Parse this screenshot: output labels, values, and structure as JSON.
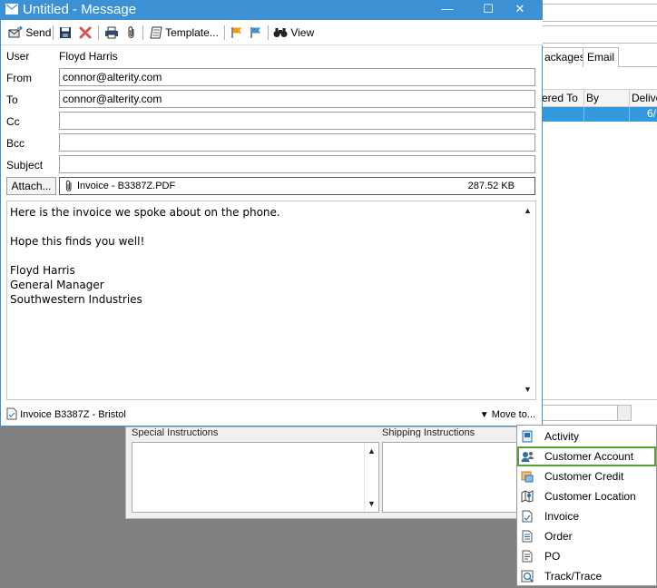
{
  "window": {
    "title": "Untitled - Message",
    "minimize": "—",
    "maximize": "☐",
    "close": "✕"
  },
  "toolbar": {
    "send": "Send",
    "template": "Template...",
    "view": "View"
  },
  "fields": {
    "user_label": "User",
    "user_value": "Floyd Harris",
    "from_label": "From",
    "from_value": "connor@alterity.com",
    "to_label": "To",
    "to_value": "connor@alterity.com",
    "cc_label": "Cc",
    "cc_value": "",
    "bcc_label": "Bcc",
    "bcc_value": "",
    "subject_label": "Subject",
    "subject_value": ""
  },
  "attachment": {
    "button": "Attach...",
    "file_name": "Invoice - B3387Z.PDF",
    "file_size": "287.52 KB"
  },
  "body": {
    "text": "Here is the invoice we spoke about on the phone.\n\nHope this finds you well!\n\nFloyd Harris\nGeneral Manager\nSouthwestern Industries"
  },
  "footer": {
    "link_text": "Invoice B3387Z - Bristol",
    "move_to": "Move to..."
  },
  "background": {
    "tab_packages": "ackages",
    "tab_email": "Email",
    "col_ordered_to": "ered To",
    "col_by": "By",
    "col_delivered": "Delive",
    "row_date": "6/",
    "special_instructions": "Special Instructions",
    "shipping_instructions": "Shipping Instructions"
  },
  "context_menu": {
    "items": [
      {
        "label": "Activity",
        "icon": "activity-icon"
      },
      {
        "label": "Customer Account",
        "icon": "customer-account-icon",
        "highlighted": true
      },
      {
        "label": "Customer Credit",
        "icon": "customer-credit-icon"
      },
      {
        "label": "Customer Location",
        "icon": "customer-location-icon"
      },
      {
        "label": "Invoice",
        "icon": "invoice-icon"
      },
      {
        "label": "Order",
        "icon": "order-icon"
      },
      {
        "label": "PO",
        "icon": "po-icon"
      },
      {
        "label": "Track/Trace",
        "icon": "track-trace-icon"
      }
    ]
  },
  "colors": {
    "title_bar": "#3c91d5",
    "selected_row": "#3399dd",
    "menu_highlight": "#58a02f"
  }
}
